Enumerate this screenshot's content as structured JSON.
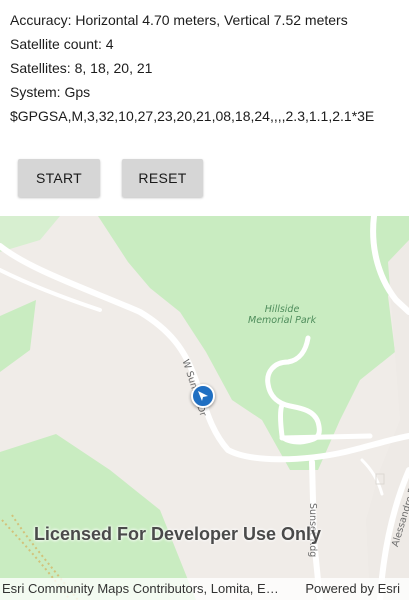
{
  "info": {
    "accuracy": "Accuracy: Horizontal 4.70 meters, Vertical  7.52 meters",
    "satellite_count": "Satellite count: 4",
    "satellites": "Satellites: 8, 18, 20, 21",
    "system": "System: Gps",
    "nmea": "$GPGSA,M,3,32,10,27,23,20,21,08,18,24,,,,2.3,1.1,2.1*3E"
  },
  "buttons": {
    "start": "START",
    "reset": "RESET"
  },
  "map": {
    "park_label_line1": "Hillside",
    "park_label_line2": "Memorial Park",
    "road_label_1": "W Sunset Dr",
    "road_label_2": "Sunset Rdg",
    "road_label_3": "Alessandro Rd",
    "license_text": "Licensed For Developer Use Only",
    "attribution": "Esri Community Maps Contributors, Lomita, Esri, HERE",
    "powered_by": "Powered by Esri",
    "colors": {
      "land": "#f0ece8",
      "park": "#c9ecc1",
      "road": "#ffffff",
      "location_marker": "#1f6fc2"
    }
  }
}
